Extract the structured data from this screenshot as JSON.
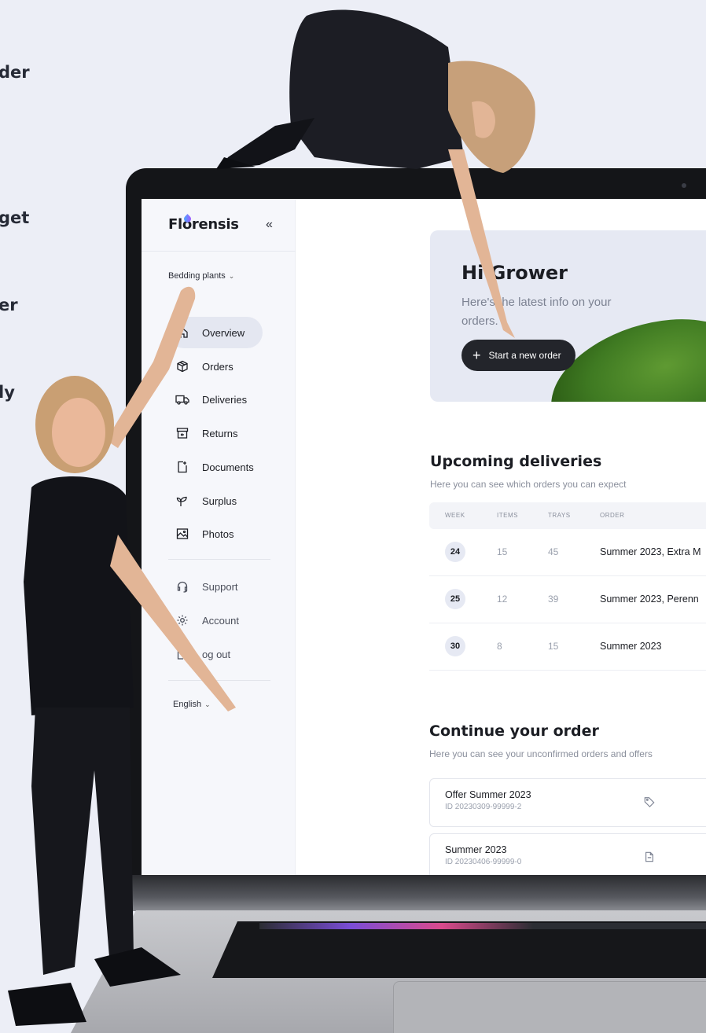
{
  "promo": {
    "lines": [
      "der",
      "",
      "get",
      "er",
      "ly"
    ]
  },
  "app": {
    "logo": "Florensis",
    "collapse": "«",
    "crop_select": "Bedding plants",
    "language": "English"
  },
  "nav": {
    "items": [
      {
        "label": "Overview",
        "icon": "home-icon"
      },
      {
        "label": "Orders",
        "icon": "box-icon"
      },
      {
        "label": "Deliveries",
        "icon": "truck-icon"
      },
      {
        "label": "Returns",
        "icon": "return-box-icon"
      },
      {
        "label": "Documents",
        "icon": "document-icon"
      },
      {
        "label": "Surplus",
        "icon": "sprout-icon"
      },
      {
        "label": "Photos",
        "icon": "image-icon"
      }
    ],
    "secondary": [
      {
        "label": "Support",
        "icon": "headset-icon"
      },
      {
        "label": "Account",
        "icon": "gear-icon"
      },
      {
        "label": "og out",
        "icon": "logout-icon"
      }
    ]
  },
  "hero": {
    "title": "Hi Grower",
    "subtitle": "Here's the latest info on your orders.",
    "button": "Start a new order"
  },
  "deliveries": {
    "title": "Upcoming deliveries",
    "subtitle": "Here you can see which orders you can expect",
    "columns": [
      "WEEK",
      "ITEMS",
      "TRAYS",
      "ORDER"
    ],
    "rows": [
      {
        "week": "24",
        "items": "15",
        "trays": "45",
        "order": "Summer 2023, Extra M"
      },
      {
        "week": "25",
        "items": "12",
        "trays": "39",
        "order": "Summer 2023, Perenn"
      },
      {
        "week": "30",
        "items": "8",
        "trays": "15",
        "order": "Summer 2023"
      }
    ]
  },
  "continue": {
    "title": "Continue your order",
    "subtitle": "Here you can see your unconfirmed orders and offers",
    "cards": [
      {
        "name": "Offer Summer 2023",
        "id": "ID 20230309-99999-2",
        "icon": "tag-icon"
      },
      {
        "name": "Summer 2023",
        "id": "ID 20230406-99999-0",
        "icon": "document-icon"
      }
    ]
  }
}
